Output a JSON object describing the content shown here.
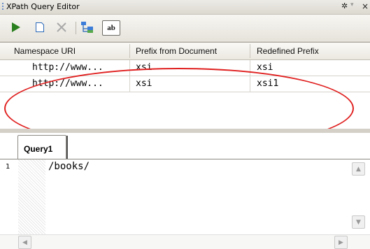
{
  "window": {
    "title": "XPath Query Editor",
    "pin_glyph": "✲",
    "dropdown_glyph": "▾",
    "close_glyph": "×"
  },
  "toolbar": {
    "buttons": [
      {
        "name": "run",
        "icon": "play-icon"
      },
      {
        "name": "new",
        "icon": "new-document-icon"
      },
      {
        "name": "delete",
        "icon": "delete-icon"
      },
      {
        "name": "namespaces",
        "icon": "namespace-tree-icon"
      },
      {
        "name": "abbreviate",
        "icon": "abbreviate-icon",
        "label": "ab"
      }
    ]
  },
  "namespace_table": {
    "columns": [
      "Namespace URI",
      "Prefix from Document",
      "Redefined Prefix"
    ],
    "rows": [
      [
        "http://www...",
        "xsi",
        "xsi"
      ],
      [
        "http://www...",
        "xsi",
        "xsi1"
      ]
    ]
  },
  "query_tabs": [
    {
      "label": "Query1",
      "active": true
    }
  ],
  "editor": {
    "line_numbers": [
      "1"
    ],
    "lines": [
      "/books/"
    ]
  },
  "colors": {
    "annotation": "#e02020",
    "play": "#2a7f1e"
  }
}
